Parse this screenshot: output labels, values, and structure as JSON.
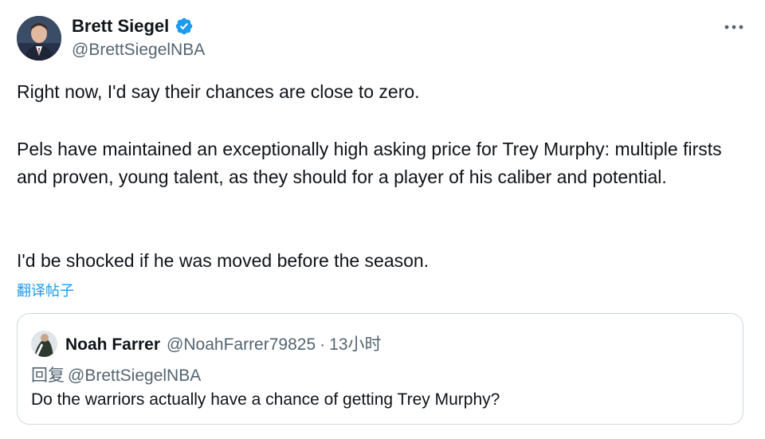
{
  "author": {
    "display_name": "Brett Siegel",
    "handle": "@BrettSiegelNBA",
    "verified": true,
    "verified_color": "#1d9bf0",
    "avatar_icon": "profile-photo"
  },
  "more_icon": "more-horizontal-icon",
  "tweet": {
    "paragraphs": [
      "Right now, I'd say their chances are close to zero.",
      "Pels have maintained an exceptionally high asking price for Trey Murphy: multiple firsts and proven, young talent, as they should for a player of his caliber and potential.",
      "I'd be shocked if he was moved before the season."
    ],
    "translate_label": "翻译帖子"
  },
  "quote": {
    "display_name": "Noah Farrer",
    "handle": "@NoahFarrer79825",
    "separator": "·",
    "time": "13小时",
    "reply_prefix": "回复",
    "reply_to": "@BrettSiegelNBA",
    "text": "Do the warriors actually have a chance of getting Trey Murphy?"
  },
  "colors": {
    "accent": "#1d9bf0",
    "text": "#0f1419",
    "secondary_text": "#536471",
    "border": "#cfd9de"
  }
}
